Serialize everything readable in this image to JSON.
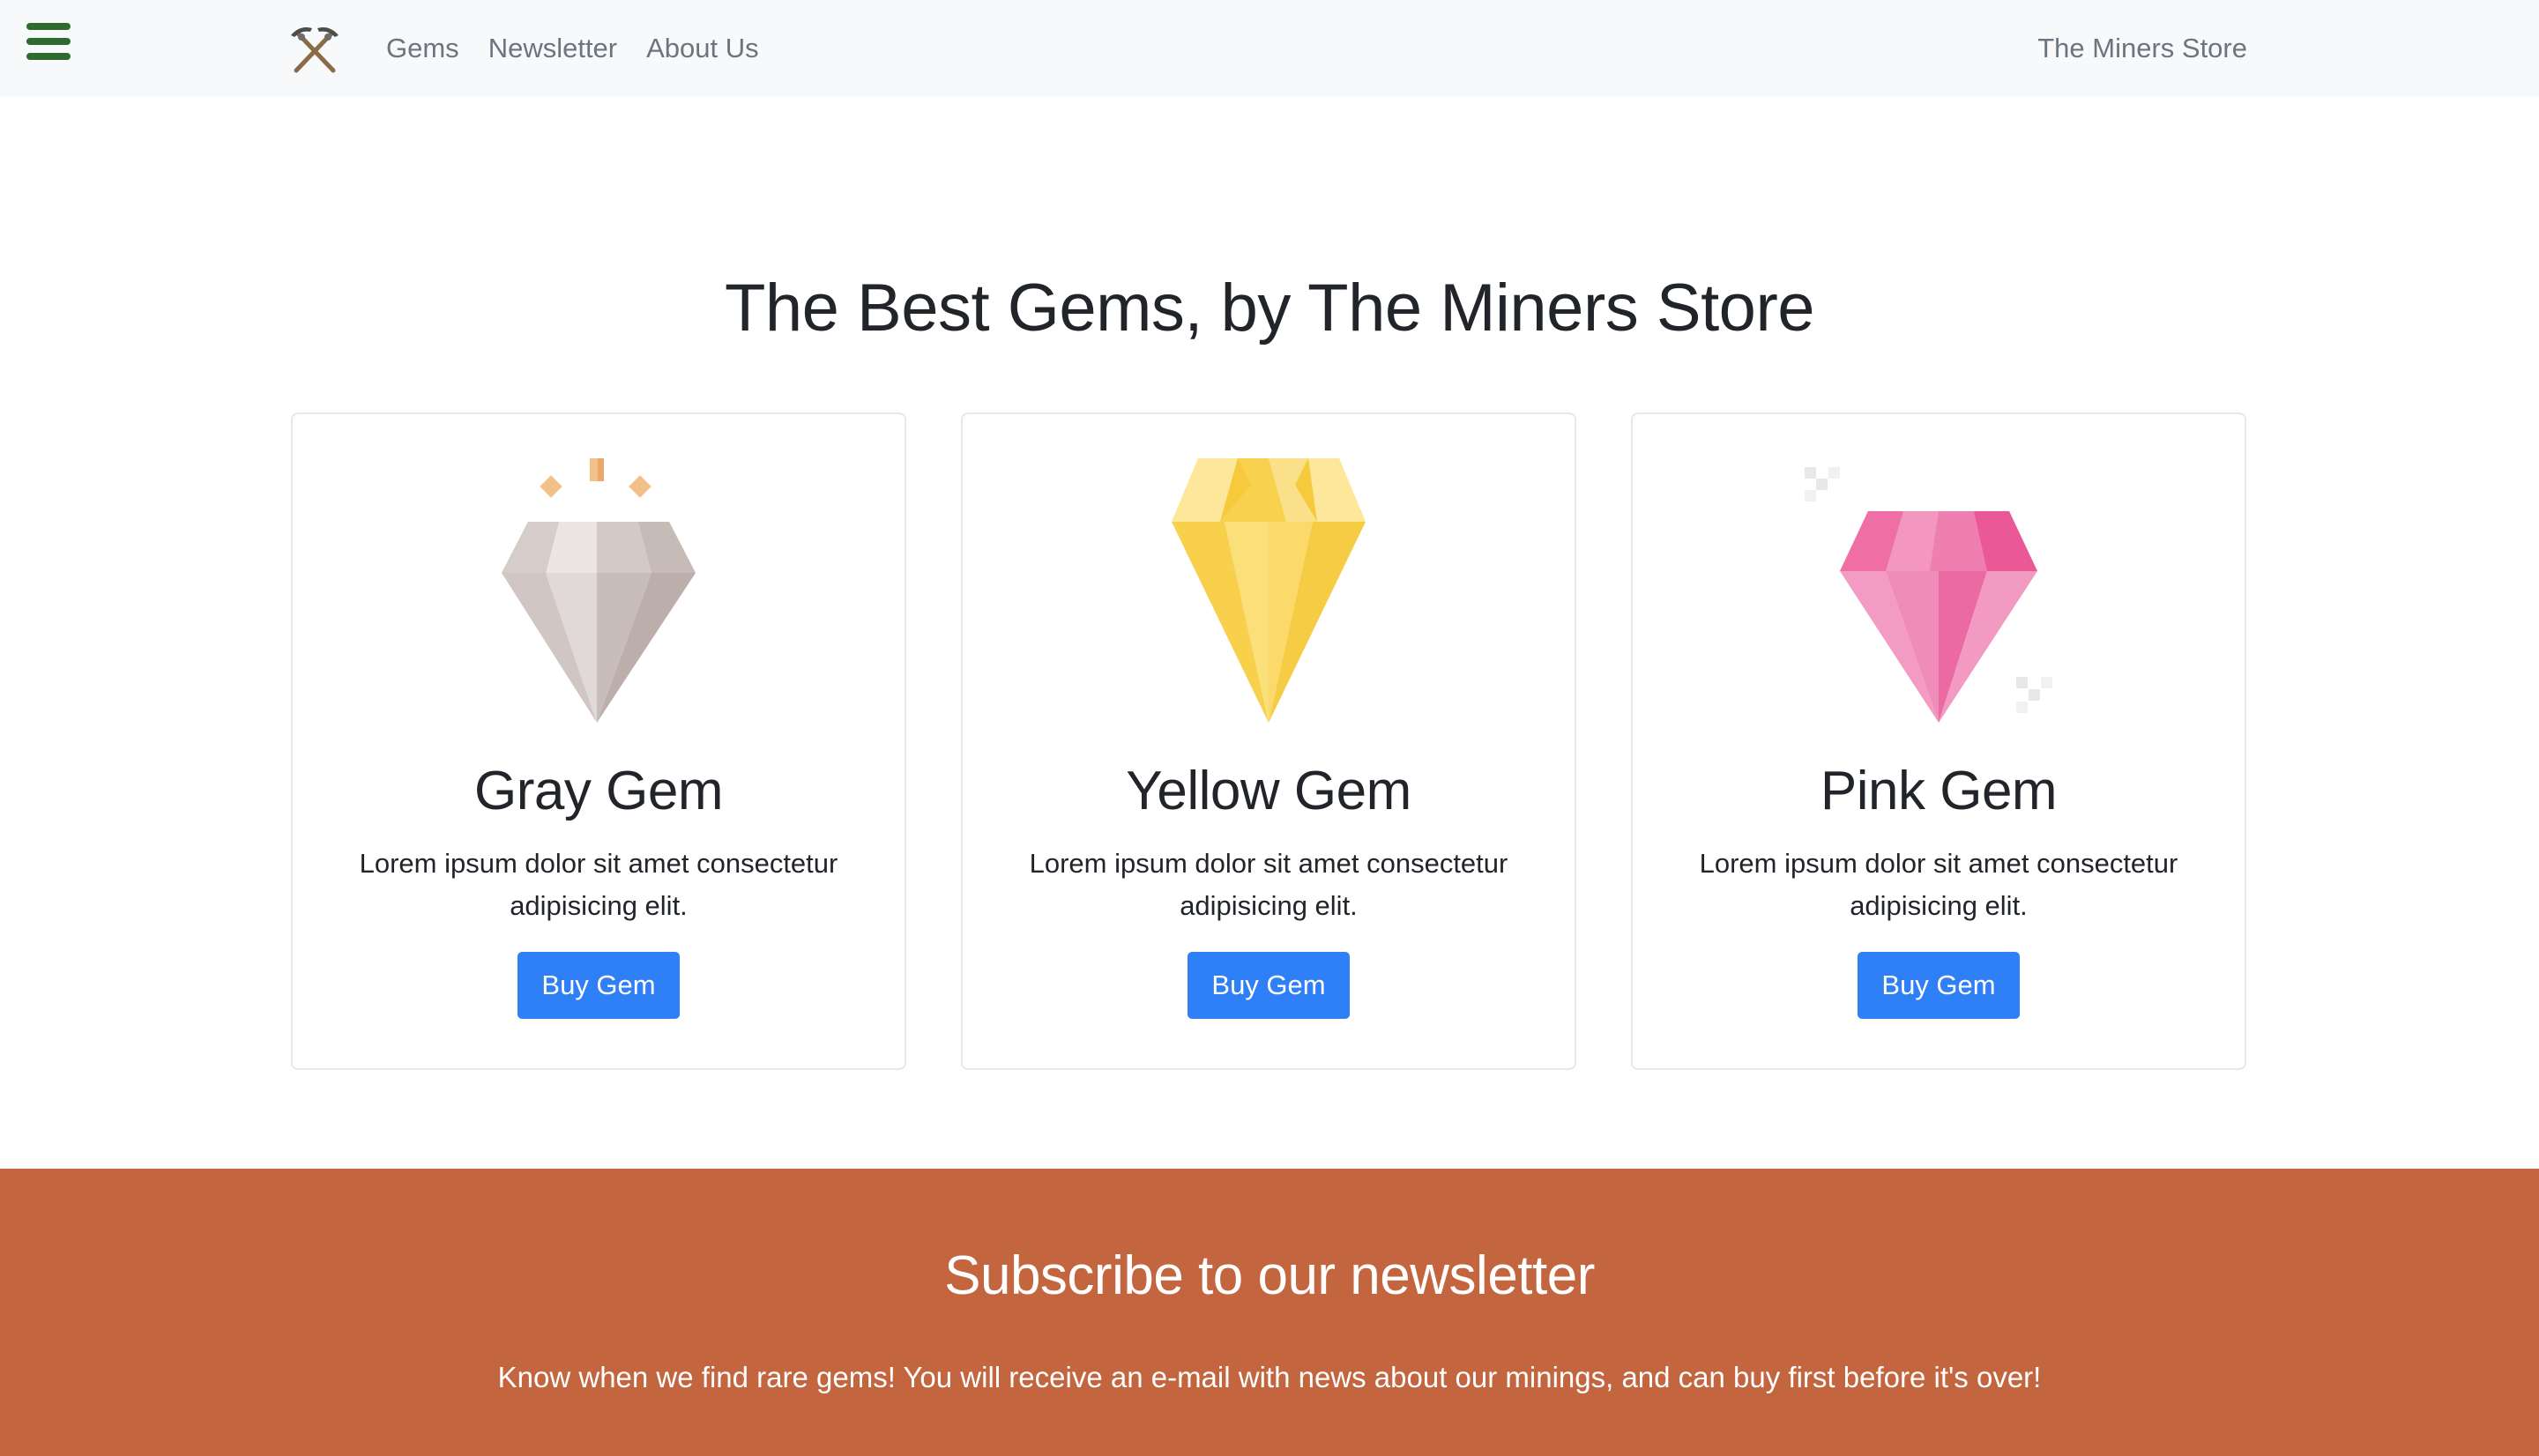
{
  "navbar": {
    "menu_icon": "hamburger-menu-icon",
    "logo_icon": "crossed-pickaxes-icon",
    "links": [
      {
        "label": "Gems"
      },
      {
        "label": "Newsletter"
      },
      {
        "label": "About Us"
      }
    ],
    "brand_name": "The Miners Store"
  },
  "main": {
    "title": "The Best Gems, by The Miners Store",
    "gems": [
      {
        "name": "Gray Gem",
        "description": "Lorem ipsum dolor sit amet consectetur adipisicing elit.",
        "button_label": "Buy Gem",
        "icon": "gray-diamond-icon",
        "color": "#cfc5c2"
      },
      {
        "name": "Yellow Gem",
        "description": "Lorem ipsum dolor sit amet consectetur adipisicing elit.",
        "button_label": "Buy Gem",
        "icon": "yellow-diamond-icon",
        "color": "#f8d24f"
      },
      {
        "name": "Pink Gem",
        "description": "Lorem ipsum dolor sit amet consectetur adipisicing elit.",
        "button_label": "Buy Gem",
        "icon": "pink-diamond-icon",
        "color": "#ee6ea5"
      }
    ]
  },
  "newsletter": {
    "title": "Subscribe to our newsletter",
    "text": "Know when we find rare gems! You will receive an e-mail with news about our minings, and can buy first before it's over!"
  },
  "colors": {
    "navbar_bg": "#f8f9fa",
    "button_blue": "#2f80f7",
    "newsletter_bg": "#c3653e",
    "menu_green": "#2f6b2e"
  }
}
